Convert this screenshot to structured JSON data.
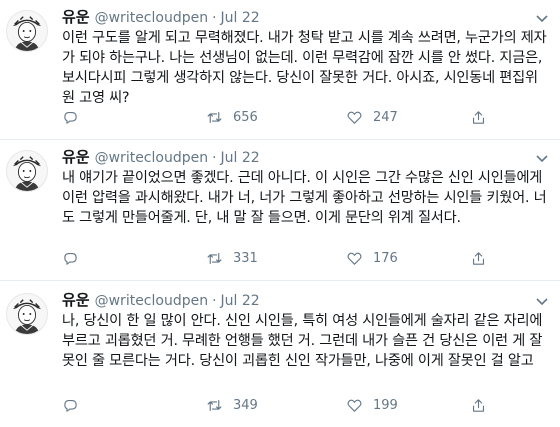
{
  "tweets": [
    {
      "name": "유운",
      "handle": "@writecloudpen",
      "separator": "·",
      "date": "Jul 22",
      "text": "이런 구도를 알게 되고 무력해졌다. 내가 청탁 받고 시를 계속 쓰려면, 누군가의 제자가 되야 하는구나. 나는 선생님이 없는데. 이런 무력감에 잠깐 시를 안 썼다. 지금은, 보시다시피 그렇게 생각하지 않는다. 당신이 잘못한 거다. 아시죠, 시인동네 편집위원 고영 씨?",
      "retweets": "656",
      "likes": "247"
    },
    {
      "name": "유운",
      "handle": "@writecloudpen",
      "separator": "·",
      "date": "Jul 22",
      "text": "내 얘기가 끝이었으면 좋겠다. 근데 아니다. 이 시인은 그간 수많은 신인 시인들에게 이런 압력을 과시해왔다. 내가 너, 너가 그렇게 좋아하고 선망하는 시인들 키웠어. 너도 그렇게 만들어줄게. 단, 내 말 잘 들으면. 이게 문단의 위계 질서다.",
      "retweets": "331",
      "likes": "176"
    },
    {
      "name": "유운",
      "handle": "@writecloudpen",
      "separator": "·",
      "date": "Jul 22",
      "text": "나, 당신이 한 일 많이 안다. 신인 시인들, 특히 여성 시인들에게 술자리 같은 자리에 부르고 괴롭혔던 거. 무례한 언행들 했던 거. 그런데 내가 슬픈 건 당신은 이런 게 잘못인 줄 모른다는 거다. 당신이 괴롭힌 신인 작가들만, 나중에 이게 잘못인 걸 알고",
      "retweets": "349",
      "likes": "199"
    }
  ],
  "icons": {
    "avatar": "avatar-illustration",
    "caret": "chevron-down-icon",
    "reply": "reply-icon",
    "retweet": "retweet-icon",
    "like": "heart-icon",
    "share": "share-icon"
  },
  "colors": {
    "text": "#14171a",
    "muted": "#657786",
    "divider": "#e6ecf0"
  }
}
